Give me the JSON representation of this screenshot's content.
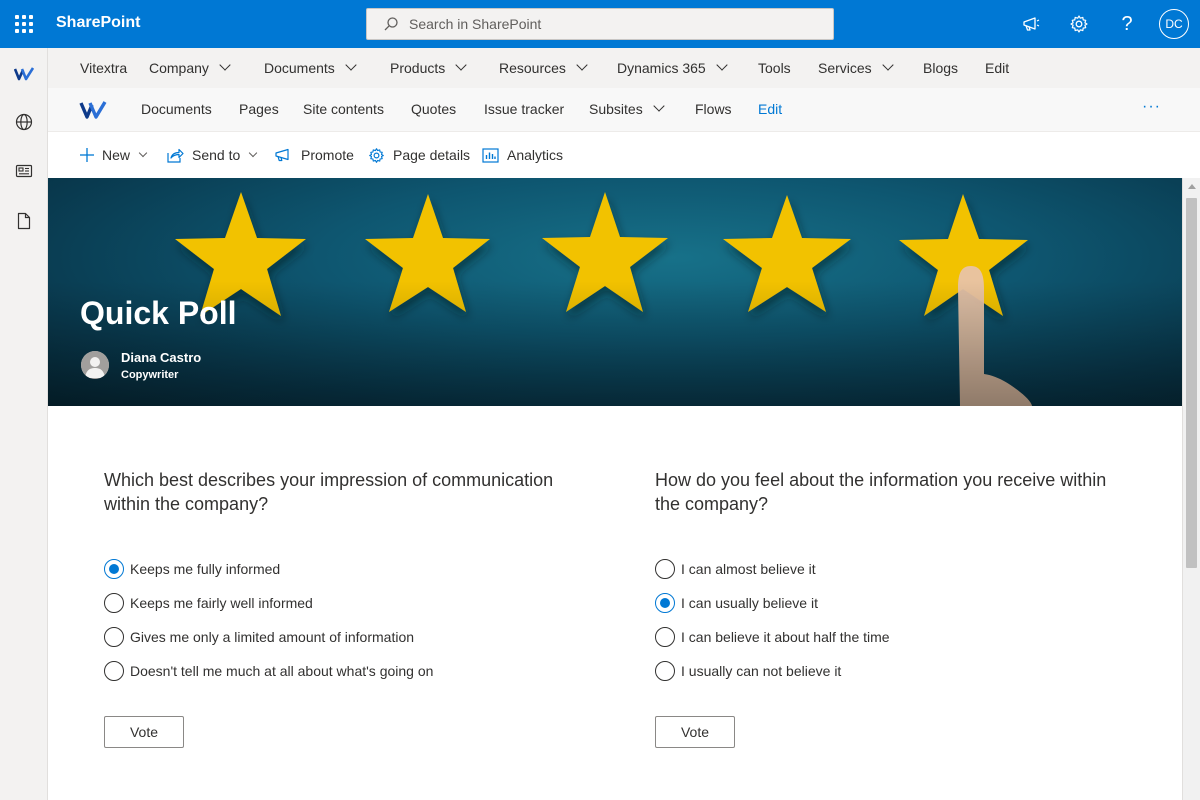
{
  "suite": {
    "brand": "SharePoint",
    "search_placeholder": "Search in SharePoint",
    "user_initials": "DC"
  },
  "hub_nav": {
    "items": [
      {
        "label": "Vitextra",
        "dropdown": false
      },
      {
        "label": "Company",
        "dropdown": true
      },
      {
        "label": "Documents",
        "dropdown": true
      },
      {
        "label": "Products",
        "dropdown": true
      },
      {
        "label": "Resources",
        "dropdown": true
      },
      {
        "label": "Dynamics 365",
        "dropdown": true
      },
      {
        "label": "Tools",
        "dropdown": false
      },
      {
        "label": "Services",
        "dropdown": true
      },
      {
        "label": "Blogs",
        "dropdown": false
      },
      {
        "label": "Edit",
        "dropdown": false
      }
    ]
  },
  "site_nav": {
    "items": [
      {
        "label": "Documents"
      },
      {
        "label": "Pages"
      },
      {
        "label": "Site contents"
      },
      {
        "label": "Quotes"
      },
      {
        "label": "Issue tracker"
      },
      {
        "label": "Subsites"
      },
      {
        "label": "Flows"
      },
      {
        "label": "Edit"
      }
    ],
    "more": "···"
  },
  "command_bar": {
    "new": "New",
    "send_to": "Send to",
    "promote": "Promote",
    "page_details": "Page details",
    "analytics": "Analytics"
  },
  "hero": {
    "title": "Quick Poll",
    "author_name": "Diana Castro",
    "author_role": "Copywriter"
  },
  "poll1": {
    "question": "Which best describes your impression of communication within the company?",
    "options": [
      {
        "label": "Keeps me fully informed",
        "checked": true
      },
      {
        "label": "Keeps me fairly well informed",
        "checked": false
      },
      {
        "label": "Gives me only a limited amount of information",
        "checked": false
      },
      {
        "label": "Doesn't tell me much at all about what's going on",
        "checked": false
      }
    ],
    "vote_label": "Vote"
  },
  "poll2": {
    "question": "How do you feel about the information you receive within the company?",
    "options": [
      {
        "label": "I can almost believe it",
        "checked": false
      },
      {
        "label": "I can usually believe it",
        "checked": true
      },
      {
        "label": "I can believe it about half the time",
        "checked": false
      },
      {
        "label": "I usually can not believe it",
        "checked": false
      }
    ],
    "vote_label": "Vote"
  },
  "colors": {
    "accent": "#0078d4",
    "star": "#f2c200"
  }
}
